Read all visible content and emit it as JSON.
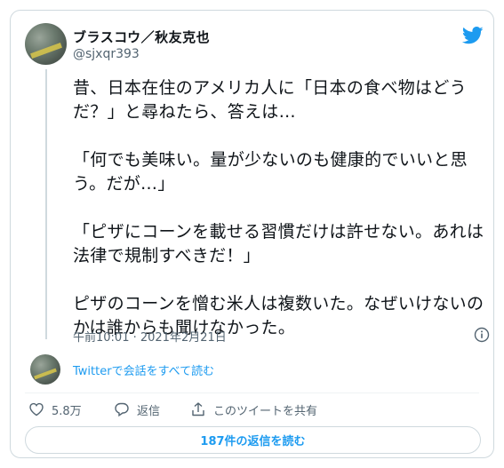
{
  "author": {
    "name": "ブラスコウ／秋友克也",
    "handle": "@sjxqr393"
  },
  "tweet": {
    "text": "昔、日本在住のアメリカ人に「日本の食べ物はどうだ？」と尋ねたら、答えは…\n\n「何でも美味い。量が少ないのも健康的でいいと思う。だが…」\n\n「ピザにコーンを載せる習慣だけは許せない。あれは法律で規制すべきだ！」\n\nピザのコーンを憎む米人は複数いた。なぜいけないのかは誰からも聞けなかった。",
    "timestamp": "午前10:01 · 2021年2月21日"
  },
  "thread_link": "Twitterで会話をすべて読む",
  "actions": {
    "likes": "5.8万",
    "reply": "返信",
    "share": "このツイートを共有"
  },
  "replies_button": "187件の返信を読む",
  "colors": {
    "accent": "#1d9bf0",
    "muted": "#536471",
    "border": "#cfd9de"
  },
  "icons": [
    "twitter-bird-icon",
    "info-icon",
    "heart-icon",
    "reply-icon",
    "share-icon"
  ]
}
